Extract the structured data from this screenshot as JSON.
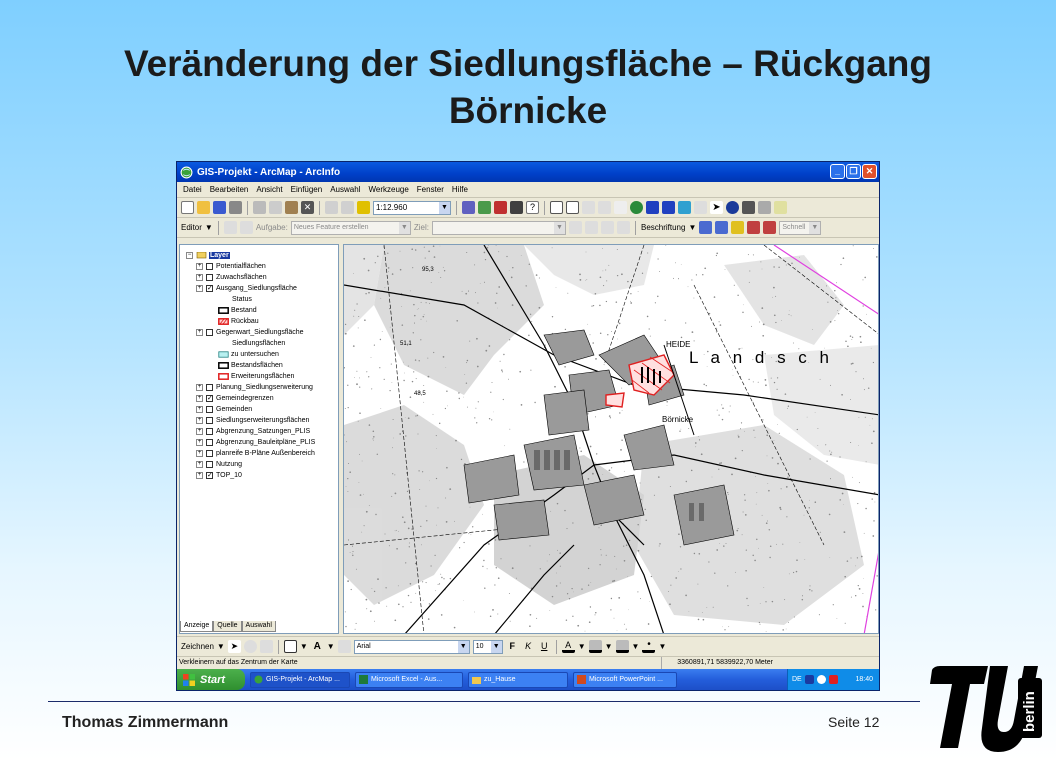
{
  "slide": {
    "title_line1": "Veränderung der Siedlungsfläche – Rückgang",
    "title_line2": "Börnicke",
    "author": "Thomas Zimmermann",
    "page": "Seite 12"
  },
  "window": {
    "title": "GIS-Projekt - ArcMap - ArcInfo",
    "menu": [
      "Datei",
      "Bearbeiten",
      "Ansicht",
      "Einfügen",
      "Auswahl",
      "Werkzeuge",
      "Fenster",
      "Hilfe"
    ],
    "scale": "1:12.960",
    "editor_label": "Editor",
    "aufgabe_label": "Aufgabe:",
    "aufgabe_value": "Neues Feature erstellen",
    "ziel_label": "Ziel:",
    "beschriftung_label": "Beschriftung",
    "schnell_value": "Schnell"
  },
  "toc": {
    "root": "Layer",
    "items": [
      {
        "label": "Potentialflächen",
        "checked": false
      },
      {
        "label": "Zuwachsflächen",
        "checked": false
      },
      {
        "label": "Ausgang_Siedlungsfläche",
        "checked": true
      },
      {
        "label": "Status",
        "legend": true
      },
      {
        "label": "Bestand",
        "legend": true
      },
      {
        "label": "Rückbau",
        "legend": true
      },
      {
        "label": "Gegenwart_Siedlungsfläche",
        "checked": false
      },
      {
        "label": "Siedlungsflächen",
        "legend": true
      },
      {
        "label": "zu untersuchen",
        "legend": true
      },
      {
        "label": "Bestandsflächen",
        "legend": true
      },
      {
        "label": "Erweiterungsflächen",
        "legend": true
      },
      {
        "label": "Planung_Siedlungserweiterung",
        "checked": false
      },
      {
        "label": "Gemeindegrenzen",
        "checked": true
      },
      {
        "label": "Gemeinden",
        "checked": false
      },
      {
        "label": "Siedlungserweiterungsflächen",
        "checked": false
      },
      {
        "label": "Abgrenzung_Satzungen_PLIS",
        "checked": false
      },
      {
        "label": "Abgrenzung_Bauleitpläne_PLIS",
        "checked": false
      },
      {
        "label": "planreife B-Pläne Außenbereich",
        "checked": false
      },
      {
        "label": "Nutzung",
        "checked": false
      },
      {
        "label": "TOP_10",
        "checked": true
      }
    ],
    "tabs": [
      "Anzeige",
      "Quelle",
      "Auswahl"
    ]
  },
  "map": {
    "labels": {
      "landsch": "L a n d s c h",
      "boernicke": "Börnicke",
      "heide": "HEIDE",
      "elev1": "95,3",
      "elev2": "51,1",
      "elev3": "48,5"
    }
  },
  "draw": {
    "zeichnen": "Zeichnen",
    "font": "Arial",
    "size": "10"
  },
  "status": {
    "message": "Verkleinern auf das Zentrum der Karte",
    "coords": "3360891,71  5839922,70 Meter"
  },
  "taskbar": {
    "start": "Start",
    "tasks": [
      "GIS-Projekt - ArcMap ...",
      "Microsoft Excel - Aus...",
      "zu_Hause",
      "Microsoft PowerPoint ..."
    ],
    "lang": "DE",
    "clock": "18:40"
  },
  "logo_text": "berlin"
}
